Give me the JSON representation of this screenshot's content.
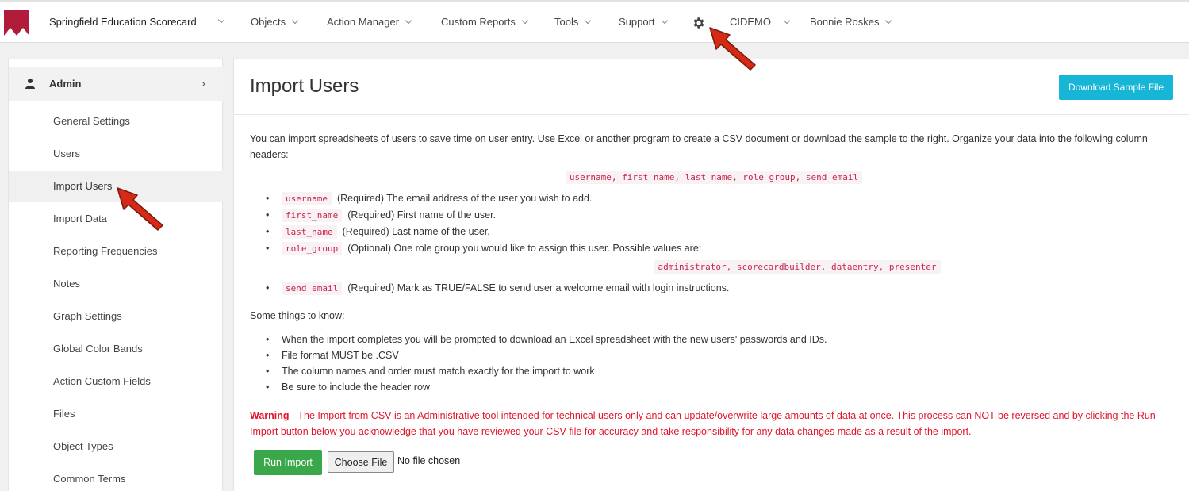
{
  "header": {
    "brand": "Springfield Education Scorecard",
    "nav": [
      {
        "label": "Objects"
      },
      {
        "label": "Action Manager"
      },
      {
        "label": "Custom Reports"
      },
      {
        "label": "Tools"
      },
      {
        "label": "Support"
      }
    ],
    "settings_icon": "gear-icon",
    "org": "CIDEMO",
    "user": "Bonnie Roskes",
    "brand_color": "#b01c3a"
  },
  "sidebar": {
    "section": "Admin",
    "items": [
      {
        "label": "General Settings"
      },
      {
        "label": "Users"
      },
      {
        "label": "Import Users",
        "active": true
      },
      {
        "label": "Import Data"
      },
      {
        "label": "Reporting Frequencies"
      },
      {
        "label": "Notes"
      },
      {
        "label": "Graph Settings"
      },
      {
        "label": "Global Color Bands"
      },
      {
        "label": "Action Custom Fields"
      },
      {
        "label": "Files"
      },
      {
        "label": "Object Types"
      },
      {
        "label": "Common Terms"
      }
    ]
  },
  "main": {
    "title": "Import Users",
    "download_label": "Download Sample File",
    "intro": "You can import spreadsheets of users to save time on user entry. Use Excel or another program to create a CSV document or download the sample to the right. Organize your data into the following column headers:",
    "header_columns": "username, first_name, last_name, role_group, send_email",
    "fields": [
      {
        "code": "username",
        "desc": "(Required) The email address of the user you wish to add."
      },
      {
        "code": "first_name",
        "desc": "(Required) First name of the user."
      },
      {
        "code": "last_name",
        "desc": "(Required) Last name of the user."
      },
      {
        "code": "role_group",
        "desc": "(Optional) One role group you would like to assign this user. Possible values are:"
      },
      {
        "code": "send_email",
        "desc": "(Required) Mark as TRUE/FALSE to send user a welcome email with login instructions."
      }
    ],
    "role_values": "administrator, scorecardbuilder, dataentry, presenter",
    "know_title": "Some things to know:",
    "tips": [
      "When the import completes you will be prompted to download an Excel spreadsheet with the new users' passwords and IDs.",
      "File format MUST be .CSV",
      "The column names and order must match exactly for the import to work",
      "Be sure to include the header row"
    ],
    "warning_label": "Warning",
    "warning_text": " - The Import from CSV is an Administrative tool intended for technical users only and can update/overwrite large amounts of data at once. This process can NOT be reversed and by clicking the Run Import button below you acknowledge that you have reviewed your CSV file for accuracy and take responsibility for any data changes made as a result of the import.",
    "run_label": "Run Import",
    "choose_label": "Choose File",
    "file_status": "No file chosen",
    "accent_color": "#17b6d6",
    "run_color": "#3aa84a",
    "warning_color": "#e3142a"
  }
}
